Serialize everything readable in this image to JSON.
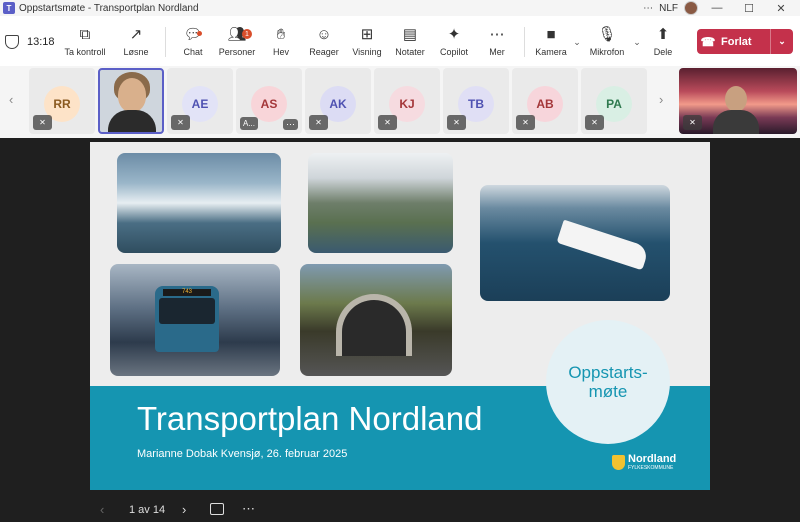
{
  "window": {
    "title": "Oppstartsmøte - Transportplan Nordland",
    "user_initials": "NLF",
    "more_label": "⋯",
    "minimize": "—",
    "maximize": "☐",
    "close": "✕"
  },
  "toolbar": {
    "timer": "13:18",
    "take_control": "Ta kontroll",
    "pop_out": "Løsne",
    "chat": "Chat",
    "people": "Personer",
    "people_badge": "1",
    "raise": "Hev",
    "react": "Reager",
    "view": "Visning",
    "notes": "Notater",
    "copilot": "Copilot",
    "more": "Mer",
    "camera": "Kamera",
    "mic": "Mikrofon",
    "share": "Dele",
    "leave": "Forlat"
  },
  "participants": [
    {
      "initials": "RR",
      "bg": "#fde3c8",
      "fg": "#8a5a20"
    },
    {
      "initials": "AE",
      "bg": "#e2e3f7",
      "fg": "#4f52b2"
    },
    {
      "initials": "AS",
      "bg": "#f8d5d9",
      "fg": "#a4373a",
      "name_tag": "A..."
    },
    {
      "initials": "AK",
      "bg": "#dcdcf4",
      "fg": "#4f52b2"
    },
    {
      "initials": "KJ",
      "bg": "#f6dbe0",
      "fg": "#a4373a"
    },
    {
      "initials": "TB",
      "bg": "#e0dff5",
      "fg": "#4f52b2"
    },
    {
      "initials": "AB",
      "bg": "#f7d5db",
      "fg": "#a4373a"
    },
    {
      "initials": "PA",
      "bg": "#d9efe4",
      "fg": "#2f7a4f"
    }
  ],
  "slide": {
    "title": "Transportplan Nordland",
    "subtitle": "Marianne Dobak Kvensjø, 26. februar 2025",
    "badge_text": "Oppstarts-møte",
    "logo_main": "Nordland",
    "logo_sub": "FYLKESKOMMUNE",
    "bus_sign": "743",
    "accent": "#1595b1"
  },
  "slide_nav": {
    "counter": "1 av 14"
  }
}
